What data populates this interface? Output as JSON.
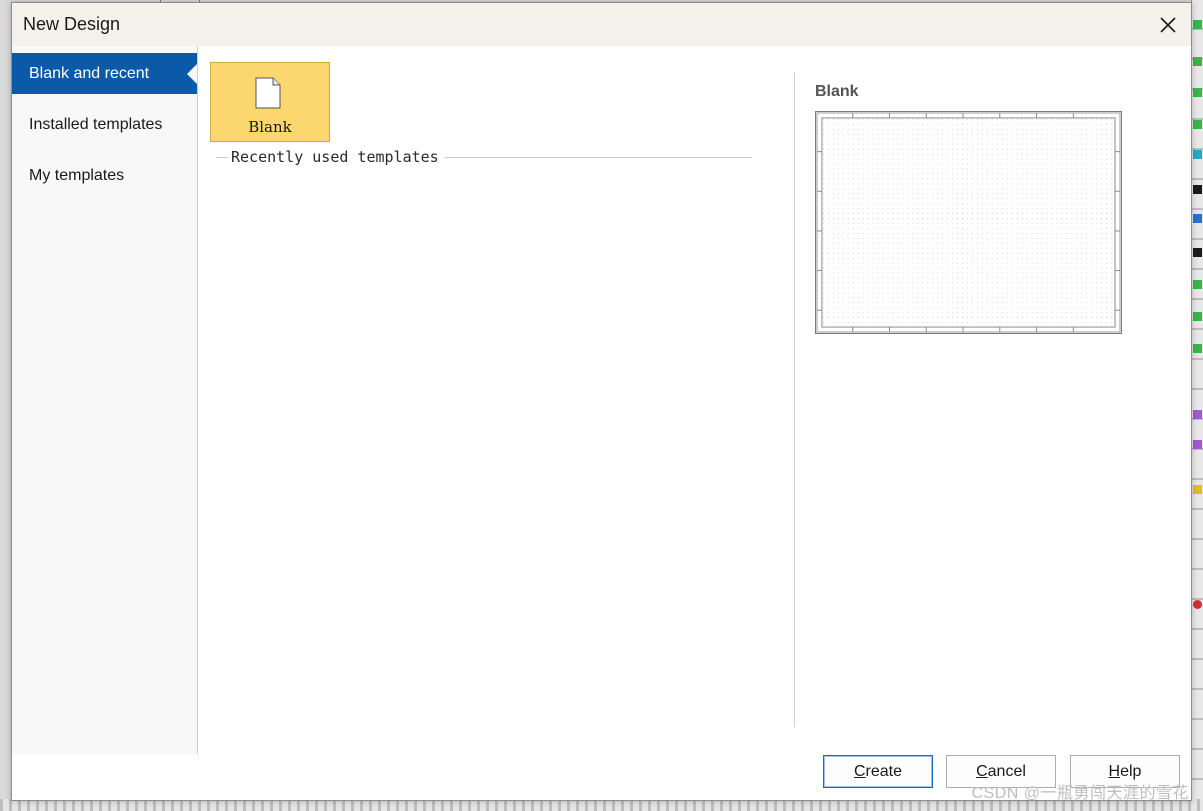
{
  "dialog": {
    "title": "New Design",
    "close_icon": "close-icon"
  },
  "sidebar": {
    "items": [
      {
        "label": "Blank and recent",
        "active": true
      },
      {
        "label": "Installed templates",
        "active": false
      },
      {
        "label": "My templates",
        "active": false
      }
    ]
  },
  "templates": {
    "tile": {
      "label": "Blank",
      "icon": "document-icon"
    },
    "section_label": "Recently used templates"
  },
  "preview": {
    "title": "Blank"
  },
  "footer": {
    "create": {
      "pre": "",
      "mnemonic": "C",
      "post": "reate"
    },
    "cancel": {
      "pre": "",
      "mnemonic": "C",
      "post": "ancel"
    },
    "help": {
      "pre": "",
      "mnemonic": "H",
      "post": "elp"
    }
  },
  "watermark": "CSDN @一瓶勇闯天涯的雪花",
  "colors": {
    "accent": "#0b5aa8",
    "tile_highlight": "#fcd66e",
    "titlebar": "#f2f2ea"
  }
}
